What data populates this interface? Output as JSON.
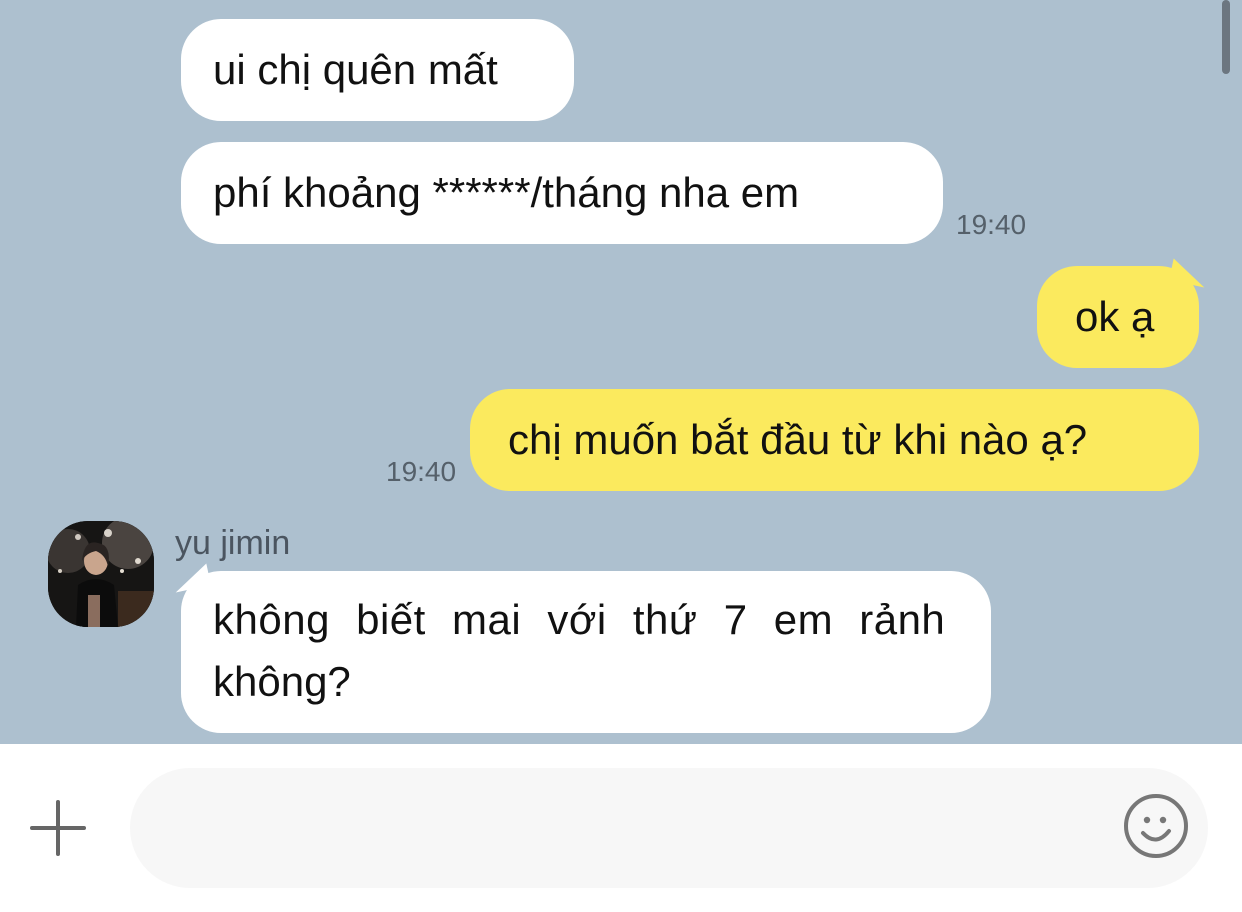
{
  "messages": [
    {
      "direction": "incoming",
      "text": "ui chị quên mất"
    },
    {
      "direction": "incoming",
      "text": "phí khoảng ******/tháng nha em",
      "time": "19:40"
    },
    {
      "direction": "outgoing",
      "text": "ok ạ"
    },
    {
      "direction": "outgoing",
      "text": "chị muốn bắt đầu từ khi nào ạ?",
      "time": "19:40"
    },
    {
      "direction": "incoming",
      "sender": "yu jimin",
      "text_line1": "không biết mai với thứ 7 em rảnh",
      "text_line2": "không?"
    }
  ],
  "composer": {
    "value": "",
    "placeholder": "",
    "plus_icon": "plus-icon",
    "emoji_icon": "smiley-icon"
  },
  "colors": {
    "chat_background": "#adc0cf",
    "incoming_bubble": "#ffffff",
    "outgoing_bubble": "#fbea5e"
  }
}
